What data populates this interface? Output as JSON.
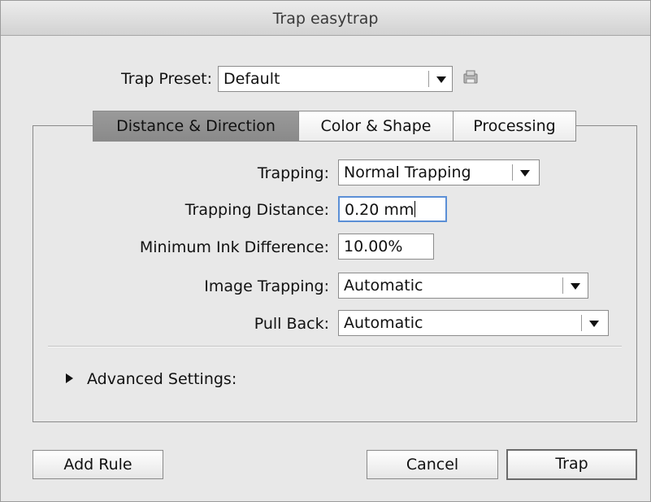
{
  "window": {
    "title": "Trap easytrap"
  },
  "preset": {
    "label": "Trap Preset:",
    "value": "Default",
    "icon": "save-preset-icon"
  },
  "tabs": [
    {
      "label": "Distance & Direction",
      "active": true
    },
    {
      "label": "Color & Shape",
      "active": false
    },
    {
      "label": "Processing",
      "active": false
    }
  ],
  "fields": {
    "trapping": {
      "label": "Trapping:",
      "value": "Normal Trapping"
    },
    "trapping_distance": {
      "label": "Trapping Distance:",
      "value": "0.20 mm"
    },
    "min_ink_difference": {
      "label": "Minimum Ink Difference:",
      "value": "10.00%"
    },
    "image_trapping": {
      "label": "Image Trapping:",
      "value": "Automatic"
    },
    "pull_back": {
      "label": "Pull Back:",
      "value": "Automatic"
    }
  },
  "advanced": {
    "label": "Advanced Settings:",
    "expanded": false
  },
  "buttons": {
    "add_rule": "Add Rule",
    "cancel": "Cancel",
    "trap": "Trap"
  }
}
